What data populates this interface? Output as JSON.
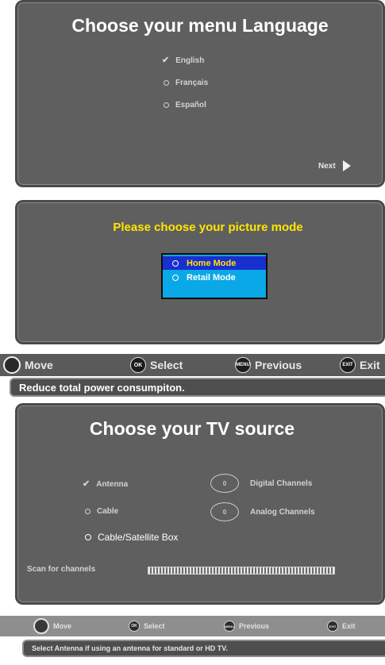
{
  "language_screen": {
    "title": "Choose your menu Language",
    "options": [
      {
        "label": "English",
        "selected": true
      },
      {
        "label": "Français",
        "selected": false
      },
      {
        "label": "Español",
        "selected": false
      }
    ],
    "next_label": "Next"
  },
  "picture_mode_screen": {
    "title": "Please choose your picture mode",
    "options": [
      {
        "label": "Home Mode",
        "selected": true
      },
      {
        "label": "Retail Mode",
        "selected": false
      }
    ]
  },
  "help_bar_1": {
    "items": [
      {
        "icon": "dpad-icon",
        "label": "Move"
      },
      {
        "icon": "ok-enter-icon",
        "button_text": "OK ENTER",
        "label": "Select"
      },
      {
        "icon": "menu-button-icon",
        "button_text": "MENU",
        "label": "Previous"
      },
      {
        "icon": "exit-button-icon",
        "button_text": "EXIT",
        "label": "Exit"
      }
    ],
    "tip": "Reduce total power consumpiton."
  },
  "source_screen": {
    "title": "Choose your TV source",
    "options": [
      {
        "label": "Antenna",
        "selected": true
      },
      {
        "label": "Cable",
        "selected": false
      },
      {
        "label": "Cable/Satellite Box",
        "selected": false
      }
    ],
    "channel_counts": [
      {
        "label": "Digital Channels",
        "value": "0"
      },
      {
        "label": "Analog Channels",
        "value": "0"
      }
    ],
    "scan_label": "Scan for channels"
  },
  "help_bar_2": {
    "items": [
      {
        "icon": "dpad-icon",
        "label": "Move"
      },
      {
        "icon": "ok-enter-icon",
        "label": "Select"
      },
      {
        "icon": "menu-button-icon",
        "label": "Previous"
      },
      {
        "icon": "exit-button-icon",
        "label": "Exit"
      }
    ],
    "tip": "Select Antenna if using an antenna for standard or HD TV."
  },
  "colors": {
    "panel_bg": "#5f5f5f",
    "highlight_blue": "#1a2fd0",
    "popup_blue": "#0aa8e6",
    "title_yellow": "#ffe600"
  }
}
